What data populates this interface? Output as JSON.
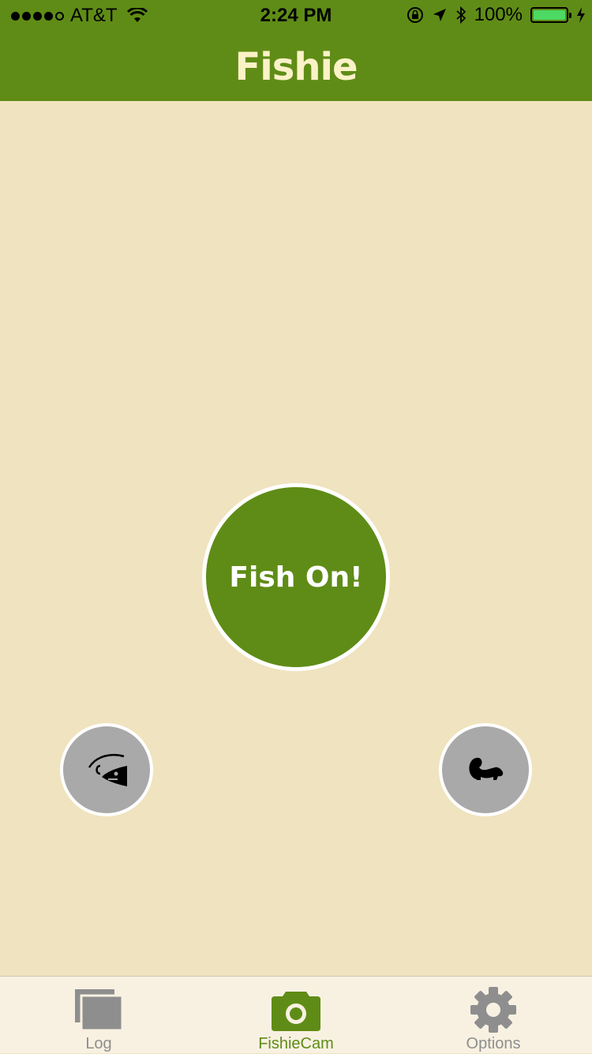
{
  "status_bar": {
    "carrier": "AT&T",
    "time": "2:24 PM",
    "battery": "100%",
    "battery_fill": 1.0
  },
  "nav": {
    "title": "Fishie"
  },
  "main": {
    "fish_on_label": "Fish On!",
    "left_button_icon": "hooked-fish-icon",
    "right_button_icon": "skunk-icon"
  },
  "tabs": [
    {
      "label": "Log",
      "icon": "log-icon",
      "active": false
    },
    {
      "label": "FishieCam",
      "icon": "camera-icon",
      "active": true
    },
    {
      "label": "Options",
      "icon": "gear-icon",
      "active": false
    }
  ],
  "colors": {
    "primary_green": "#5f8c16",
    "background": "#f0e3bf",
    "title_text": "#fbf2c8",
    "inactive_tab": "#8e8e8e",
    "side_button": "#a9a9a9"
  }
}
